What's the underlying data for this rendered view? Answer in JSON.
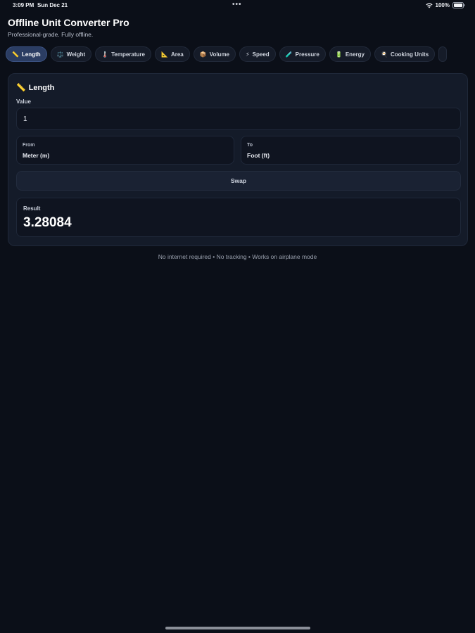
{
  "status_bar": {
    "time": "3:09 PM",
    "date": "Sun Dec 21",
    "dots": "•••",
    "battery": "100%"
  },
  "header": {
    "title": "Offline Unit Converter Pro",
    "subtitle": "Professional-grade. Fully offline."
  },
  "tabs": [
    {
      "icon": "📏",
      "label": "Length"
    },
    {
      "icon": "⚖️",
      "label": "Weight"
    },
    {
      "icon": "🌡️",
      "label": "Temperature"
    },
    {
      "icon": "📐",
      "label": "Area"
    },
    {
      "icon": "📦",
      "label": "Volume"
    },
    {
      "icon": "⚡",
      "label": "Speed"
    },
    {
      "icon": "🧪",
      "label": "Pressure"
    },
    {
      "icon": "🔋",
      "label": "Energy"
    },
    {
      "icon": "🍳",
      "label": "Cooking Units"
    }
  ],
  "converter": {
    "icon": "📏",
    "title": "Length",
    "value_label": "Value",
    "value": "1",
    "from_label": "From",
    "from_value": "Meter (m)",
    "to_label": "To",
    "to_value": "Foot (ft)",
    "swap_label": "Swap",
    "result_label": "Result",
    "result_value": "3.28084"
  },
  "footer": "No internet required • No tracking • Works on airplane mode",
  "colors": {
    "background": "#0b0f18",
    "card": "#141b29",
    "active_tab": "#2b3d63"
  }
}
